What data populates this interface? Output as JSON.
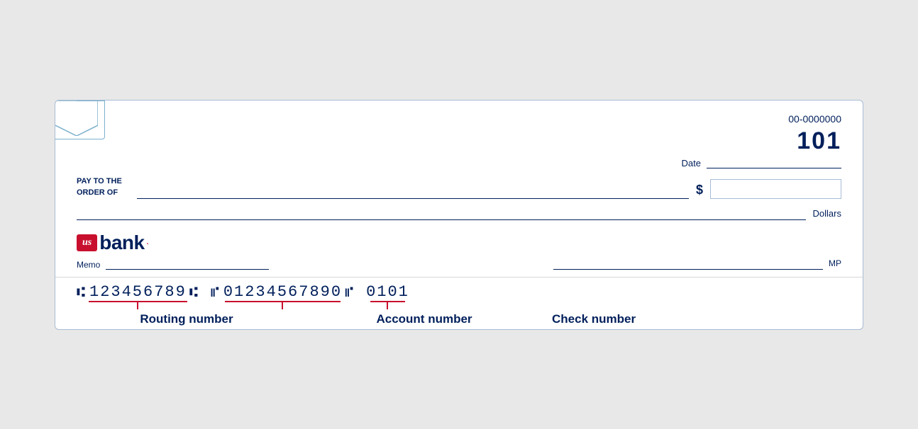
{
  "check": {
    "bank_id": "00-0000000",
    "check_number": "101",
    "date_label": "Date",
    "pay_to_label": "PAY TO THE\nORDER OF",
    "dollar_sign": "$",
    "dollars_label": "Dollars",
    "memo_label": "Memo",
    "mp_label": "MP",
    "routing_number": "123456789",
    "account_number": "01234567890",
    "check_num_micr": "0101",
    "routing_label": "Routing number",
    "account_label": "Account number",
    "check_label": "Check number"
  },
  "logo": {
    "shield_text": "us",
    "bank_text": "bank",
    "dot": "."
  }
}
